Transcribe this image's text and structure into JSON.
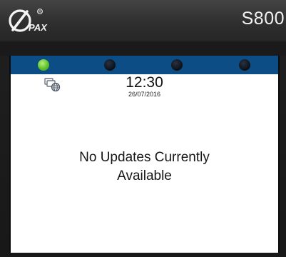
{
  "device": {
    "brand": "PAX",
    "model": "S800"
  },
  "status_bar": {
    "color": "#0c4d86",
    "leds": [
      {
        "name": "led-1",
        "state": "on",
        "color": "#5fc22a"
      },
      {
        "name": "led-2",
        "state": "off"
      },
      {
        "name": "led-3",
        "state": "off"
      },
      {
        "name": "led-4",
        "state": "off"
      }
    ]
  },
  "screen": {
    "network_icon": "network-globe-icon",
    "time": "12:30",
    "date": "26/07/2016",
    "message_line1": "No Updates Currently",
    "message_line2": "Available"
  }
}
